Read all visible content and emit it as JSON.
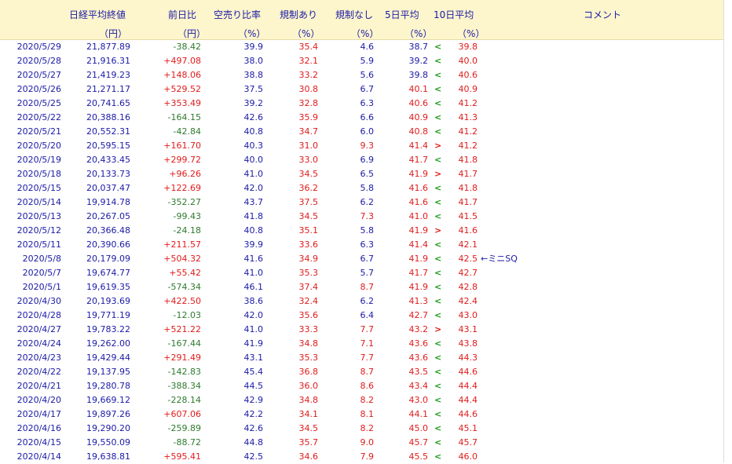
{
  "headers": {
    "nikkei": "日経平均終値",
    "change": "前日比",
    "short_ratio": "空売り比率",
    "regulated": "規制あり",
    "unregulated": "規制なし",
    "avg5": "5日平均",
    "avg10": "10日平均",
    "comment": "コメント",
    "unit_yen1": "（円）",
    "unit_yen2": "（円）",
    "unit_pct1": "（%）",
    "unit_pct2": "（%）",
    "unit_pct3": "（%）",
    "unit_pct4": "（%）",
    "unit_pct5": "（%）"
  },
  "rows": [
    {
      "date": "2020/5/29",
      "close": "21,877.89",
      "change": "-38.42",
      "short": "39.9",
      "reg": "35.4",
      "unreg": "4.6",
      "avg5": "38.7",
      "cmp": "<",
      "avg10": "39.8",
      "comment": ""
    },
    {
      "date": "2020/5/28",
      "close": "21,916.31",
      "change": "+497.08",
      "short": "38.0",
      "reg": "32.1",
      "unreg": "5.9",
      "avg5": "39.2",
      "cmp": "<",
      "avg10": "40.0",
      "comment": ""
    },
    {
      "date": "2020/5/27",
      "close": "21,419.23",
      "change": "+148.06",
      "short": "38.8",
      "reg": "33.2",
      "unreg": "5.6",
      "avg5": "39.8",
      "cmp": "<",
      "avg10": "40.6",
      "comment": ""
    },
    {
      "date": "2020/5/26",
      "close": "21,271.17",
      "change": "+529.52",
      "short": "37.5",
      "reg": "30.8",
      "unreg": "6.7",
      "avg5": "40.1",
      "cmp": "<",
      "avg10": "40.9",
      "comment": ""
    },
    {
      "date": "2020/5/25",
      "close": "20,741.65",
      "change": "+353.49",
      "short": "39.2",
      "reg": "32.8",
      "unreg": "6.3",
      "avg5": "40.6",
      "cmp": "<",
      "avg10": "41.2",
      "comment": ""
    },
    {
      "date": "2020/5/22",
      "close": "20,388.16",
      "change": "-164.15",
      "short": "42.6",
      "reg": "35.9",
      "unreg": "6.6",
      "avg5": "40.9",
      "cmp": "<",
      "avg10": "41.3",
      "comment": ""
    },
    {
      "date": "2020/5/21",
      "close": "20,552.31",
      "change": "-42.84",
      "short": "40.8",
      "reg": "34.7",
      "unreg": "6.0",
      "avg5": "40.8",
      "cmp": "<",
      "avg10": "41.2",
      "comment": ""
    },
    {
      "date": "2020/5/20",
      "close": "20,595.15",
      "change": "+161.70",
      "short": "40.3",
      "reg": "31.0",
      "unreg": "9.3",
      "avg5": "41.4",
      "cmp": ">",
      "avg10": "41.2",
      "comment": ""
    },
    {
      "date": "2020/5/19",
      "close": "20,433.45",
      "change": "+299.72",
      "short": "40.0",
      "reg": "33.0",
      "unreg": "6.9",
      "avg5": "41.7",
      "cmp": "<",
      "avg10": "41.8",
      "comment": ""
    },
    {
      "date": "2020/5/18",
      "close": "20,133.73",
      "change": "+96.26",
      "short": "41.0",
      "reg": "34.5",
      "unreg": "6.5",
      "avg5": "41.9",
      "cmp": ">",
      "avg10": "41.7",
      "comment": ""
    },
    {
      "date": "2020/5/15",
      "close": "20,037.47",
      "change": "+122.69",
      "short": "42.0",
      "reg": "36.2",
      "unreg": "5.8",
      "avg5": "41.6",
      "cmp": "<",
      "avg10": "41.8",
      "comment": ""
    },
    {
      "date": "2020/5/14",
      "close": "19,914.78",
      "change": "-352.27",
      "short": "43.7",
      "reg": "37.5",
      "unreg": "6.2",
      "avg5": "41.6",
      "cmp": "<",
      "avg10": "41.7",
      "comment": ""
    },
    {
      "date": "2020/5/13",
      "close": "20,267.05",
      "change": "-99.43",
      "short": "41.8",
      "reg": "34.5",
      "unreg": "7.3",
      "avg5": "41.0",
      "cmp": "<",
      "avg10": "41.5",
      "comment": ""
    },
    {
      "date": "2020/5/12",
      "close": "20,366.48",
      "change": "-24.18",
      "short": "40.8",
      "reg": "35.1",
      "unreg": "5.8",
      "avg5": "41.9",
      "cmp": ">",
      "avg10": "41.6",
      "comment": ""
    },
    {
      "date": "2020/5/11",
      "close": "20,390.66",
      "change": "+211.57",
      "short": "39.9",
      "reg": "33.6",
      "unreg": "6.3",
      "avg5": "41.4",
      "cmp": "<",
      "avg10": "42.1",
      "comment": ""
    },
    {
      "date": "2020/5/8",
      "close": "20,179.09",
      "change": "+504.32",
      "short": "41.6",
      "reg": "34.9",
      "unreg": "6.7",
      "avg5": "41.9",
      "cmp": "<",
      "avg10": "42.5",
      "comment": "←ミニSQ"
    },
    {
      "date": "2020/5/7",
      "close": "19,674.77",
      "change": "+55.42",
      "short": "41.0",
      "reg": "35.3",
      "unreg": "5.7",
      "avg5": "41.7",
      "cmp": "<",
      "avg10": "42.7",
      "comment": ""
    },
    {
      "date": "2020/5/1",
      "close": "19,619.35",
      "change": "-574.34",
      "short": "46.1",
      "reg": "37.4",
      "unreg": "8.7",
      "avg5": "41.9",
      "cmp": "<",
      "avg10": "42.8",
      "comment": ""
    },
    {
      "date": "2020/4/30",
      "close": "20,193.69",
      "change": "+422.50",
      "short": "38.6",
      "reg": "32.4",
      "unreg": "6.2",
      "avg5": "41.3",
      "cmp": "<",
      "avg10": "42.4",
      "comment": ""
    },
    {
      "date": "2020/4/28",
      "close": "19,771.19",
      "change": "-12.03",
      "short": "42.0",
      "reg": "35.6",
      "unreg": "6.4",
      "avg5": "42.7",
      "cmp": "<",
      "avg10": "43.0",
      "comment": ""
    },
    {
      "date": "2020/4/27",
      "close": "19,783.22",
      "change": "+521.22",
      "short": "41.0",
      "reg": "33.3",
      "unreg": "7.7",
      "avg5": "43.2",
      "cmp": ">",
      "avg10": "43.1",
      "comment": ""
    },
    {
      "date": "2020/4/24",
      "close": "19,262.00",
      "change": "-167.44",
      "short": "41.9",
      "reg": "34.8",
      "unreg": "7.1",
      "avg5": "43.6",
      "cmp": "<",
      "avg10": "43.8",
      "comment": ""
    },
    {
      "date": "2020/4/23",
      "close": "19,429.44",
      "change": "+291.49",
      "short": "43.1",
      "reg": "35.3",
      "unreg": "7.7",
      "avg5": "43.6",
      "cmp": "<",
      "avg10": "44.3",
      "comment": ""
    },
    {
      "date": "2020/4/22",
      "close": "19,137.95",
      "change": "-142.83",
      "short": "45.4",
      "reg": "36.8",
      "unreg": "8.7",
      "avg5": "43.5",
      "cmp": "<",
      "avg10": "44.6",
      "comment": ""
    },
    {
      "date": "2020/4/21",
      "close": "19,280.78",
      "change": "-388.34",
      "short": "44.5",
      "reg": "36.0",
      "unreg": "8.6",
      "avg5": "43.4",
      "cmp": "<",
      "avg10": "44.4",
      "comment": ""
    },
    {
      "date": "2020/4/20",
      "close": "19,669.12",
      "change": "-228.14",
      "short": "42.9",
      "reg": "34.8",
      "unreg": "8.2",
      "avg5": "43.0",
      "cmp": "<",
      "avg10": "44.4",
      "comment": ""
    },
    {
      "date": "2020/4/17",
      "close": "19,897.26",
      "change": "+607.06",
      "short": "42.2",
      "reg": "34.1",
      "unreg": "8.1",
      "avg5": "44.1",
      "cmp": "<",
      "avg10": "44.6",
      "comment": ""
    },
    {
      "date": "2020/4/16",
      "close": "19,290.20",
      "change": "-259.89",
      "short": "42.6",
      "reg": "34.5",
      "unreg": "8.2",
      "avg5": "45.0",
      "cmp": "<",
      "avg10": "45.1",
      "comment": ""
    },
    {
      "date": "2020/4/15",
      "close": "19,550.09",
      "change": "-88.72",
      "short": "44.8",
      "reg": "35.7",
      "unreg": "9.0",
      "avg5": "45.7",
      "cmp": "<",
      "avg10": "45.7",
      "comment": ""
    },
    {
      "date": "2020/4/14",
      "close": "19,638.81",
      "change": "+595.41",
      "short": "42.5",
      "reg": "34.6",
      "unreg": "7.9",
      "avg5": "45.5",
      "cmp": "<",
      "avg10": "46.0",
      "comment": ""
    }
  ]
}
